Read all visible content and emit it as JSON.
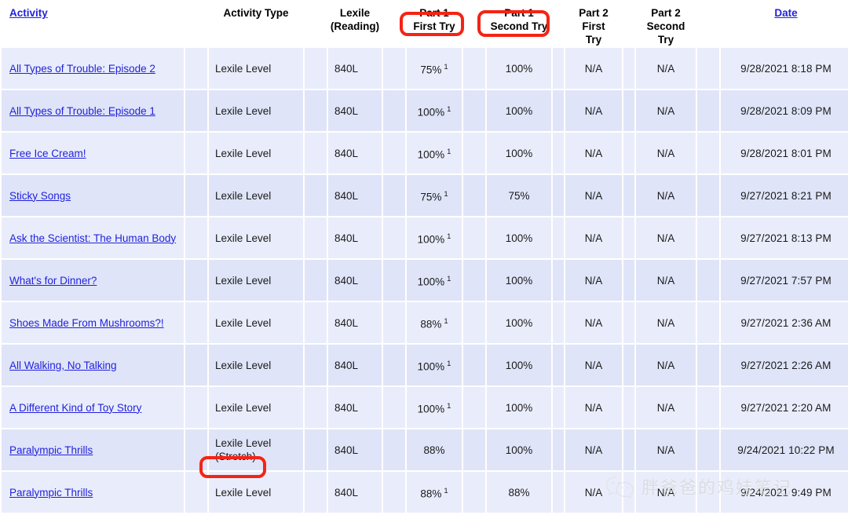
{
  "table": {
    "headers": {
      "activity": "Activity",
      "activity_type": "Activity Type",
      "lexile_line1": "Lexile",
      "lexile_line2": "(Reading)",
      "part1_label": "Part 1",
      "part1_first_try": "First Try",
      "part1_second_try": "Second Try",
      "part2_label": "Part 2",
      "part2_first_try_line1": "First",
      "part2_first_try_line2": "Try",
      "part2_second_try_line1": "Second",
      "part2_second_try_line2": "Try",
      "date": "Date"
    },
    "rows": [
      {
        "activity": "All Types of Trouble: Episode 2",
        "activity_type": "Lexile Level",
        "activity_type_note": "",
        "lexile": "840L",
        "p1_first": "75%",
        "p1_first_footnote": "1",
        "p1_second": "100%",
        "p2_first": "N/A",
        "p2_second": "N/A",
        "date": "9/28/2021  8:18 PM"
      },
      {
        "activity": "All Types of Trouble: Episode 1",
        "activity_type": "Lexile Level",
        "activity_type_note": "",
        "lexile": "840L",
        "p1_first": "100%",
        "p1_first_footnote": "1",
        "p1_second": "100%",
        "p2_first": "N/A",
        "p2_second": "N/A",
        "date": "9/28/2021  8:09 PM"
      },
      {
        "activity": "Free Ice Cream!",
        "activity_type": "Lexile Level",
        "activity_type_note": "",
        "lexile": "840L",
        "p1_first": "100%",
        "p1_first_footnote": "1",
        "p1_second": "100%",
        "p2_first": "N/A",
        "p2_second": "N/A",
        "date": "9/28/2021  8:01 PM"
      },
      {
        "activity": "Sticky Songs",
        "activity_type": "Lexile Level",
        "activity_type_note": "",
        "lexile": "840L",
        "p1_first": "75%",
        "p1_first_footnote": "1",
        "p1_second": "75%",
        "p2_first": "N/A",
        "p2_second": "N/A",
        "date": "9/27/2021  8:21 PM"
      },
      {
        "activity": "Ask the Scientist: The Human Body",
        "activity_type": "Lexile Level",
        "activity_type_note": "",
        "lexile": "840L",
        "p1_first": "100%",
        "p1_first_footnote": "1",
        "p1_second": "100%",
        "p2_first": "N/A",
        "p2_second": "N/A",
        "date": "9/27/2021  8:13 PM"
      },
      {
        "activity": "What's for Dinner?",
        "activity_type": "Lexile Level",
        "activity_type_note": "",
        "lexile": "840L",
        "p1_first": "100%",
        "p1_first_footnote": "1",
        "p1_second": "100%",
        "p2_first": "N/A",
        "p2_second": "N/A",
        "date": "9/27/2021  7:57 PM"
      },
      {
        "activity": "Shoes Made From Mushrooms?!",
        "activity_type": "Lexile Level",
        "activity_type_note": "",
        "lexile": "840L",
        "p1_first": "88%",
        "p1_first_footnote": "1",
        "p1_second": "100%",
        "p2_first": "N/A",
        "p2_second": "N/A",
        "date": "9/27/2021  2:36 AM"
      },
      {
        "activity": "All Walking, No Talking",
        "activity_type": "Lexile Level",
        "activity_type_note": "",
        "lexile": "840L",
        "p1_first": "100%",
        "p1_first_footnote": "1",
        "p1_second": "100%",
        "p2_first": "N/A",
        "p2_second": "N/A",
        "date": "9/27/2021  2:26 AM"
      },
      {
        "activity": "A Different Kind of Toy Story",
        "activity_type": "Lexile Level",
        "activity_type_note": "",
        "lexile": "840L",
        "p1_first": "100%",
        "p1_first_footnote": "1",
        "p1_second": "100%",
        "p2_first": "N/A",
        "p2_second": "N/A",
        "date": "9/27/2021  2:20 AM"
      },
      {
        "activity": "Paralympic Thrills",
        "activity_type": "Lexile Level",
        "activity_type_note": "(Stretch)",
        "lexile": "840L",
        "p1_first": "88%",
        "p1_first_footnote": "",
        "p1_second": "100%",
        "p2_first": "N/A",
        "p2_second": "N/A",
        "date": "9/24/2021 10:22 PM"
      },
      {
        "activity": "Paralympic Thrills",
        "activity_type": "Lexile Level",
        "activity_type_note": "",
        "lexile": "840L",
        "p1_first": "88%",
        "p1_first_footnote": "1",
        "p1_second": "88%",
        "p2_first": "N/A",
        "p2_second": "N/A",
        "date": "9/24/2021  9:49 PM"
      }
    ]
  },
  "annotations": {
    "color": "#f42414",
    "items": [
      {
        "id": "first-try",
        "target": "Part 1 First Try header"
      },
      {
        "id": "second-try",
        "target": "Part 1 Second Try header"
      },
      {
        "id": "stretch",
        "target": "(Stretch)"
      }
    ]
  },
  "watermark": {
    "text": "胖爸爸的鸡娃笔记",
    "logo": "wechat-logo",
    "color": "#cfcfcf"
  },
  "colors": {
    "link": "#2222dd",
    "row_light": "#e9edfb",
    "row_dark": "#dfe4f8",
    "annotation_red": "#f42414"
  }
}
